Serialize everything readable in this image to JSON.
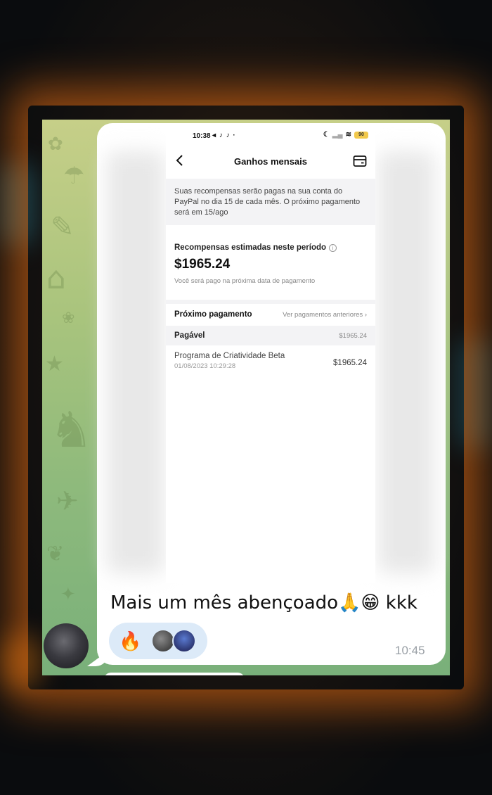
{
  "status_bar": {
    "time": "10:38",
    "left_icons": "◂ ♪ ♪ ·",
    "battery": "90"
  },
  "screen": {
    "title": "Ganhos mensais",
    "notice": "Suas recompensas serão pagas na sua conta do PayPal no dia 15 de cada mês. O próximo pagamento será em 15/ago",
    "estimated_label": "Recompensas estimadas neste período",
    "estimated_amount": "$1965.24",
    "estimated_sub": "Você será pago na próxima data de pagamento",
    "next_payment_title": "Próximo pagamento",
    "previous_payments_link": "Ver pagamentos anteriores",
    "payable_label": "Pagável",
    "payable_amount": "$1965.24",
    "program_name": "Programa de Criatividade Beta",
    "program_date": "01/08/2023 10:29:28",
    "program_amount": "$1965.24"
  },
  "message": {
    "text": "Mais um mês abençoado🙏😁 kkk",
    "time": "10:45",
    "reaction_emoji": "🔥"
  },
  "colors": {
    "bubble": "#ffffff",
    "reaction_bg": "#dceaf8",
    "timestamp": "#9aa0a6",
    "chat_wallpaper": "#a9c47d"
  }
}
